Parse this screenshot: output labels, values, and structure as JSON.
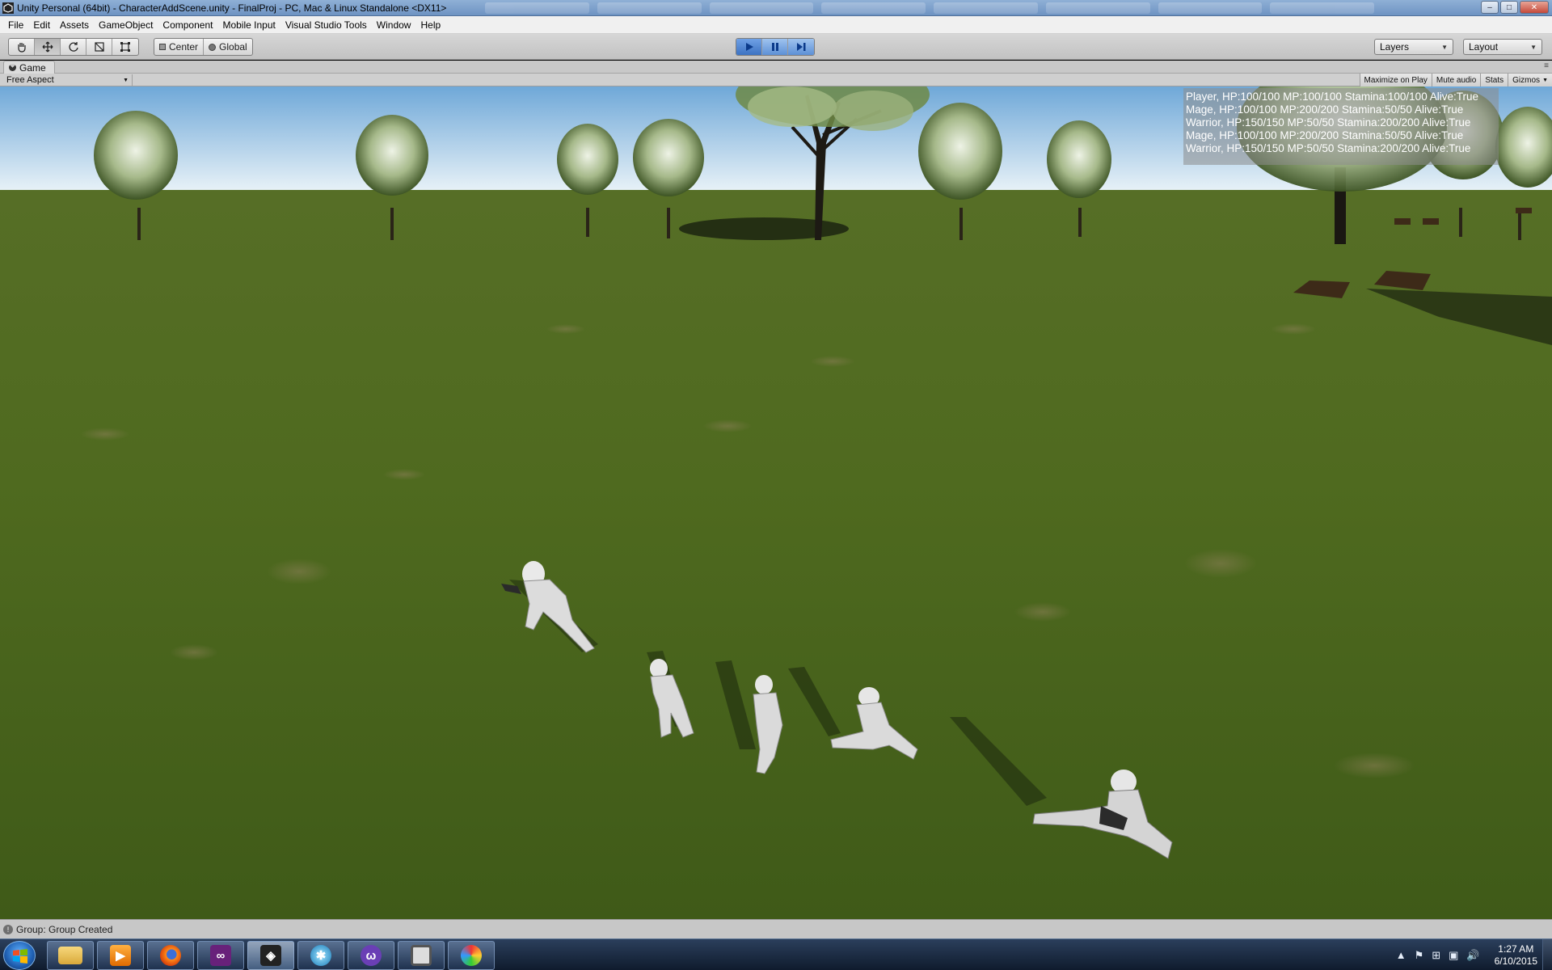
{
  "window": {
    "title": "Unity Personal (64bit) - CharacterAddScene.unity - FinalProj - PC, Mac & Linux Standalone <DX11>",
    "buttons": {
      "minimize": "–",
      "maximize": "□",
      "close": "✕"
    }
  },
  "menubar": {
    "items": [
      "File",
      "Edit",
      "Assets",
      "GameObject",
      "Component",
      "Mobile Input",
      "Visual Studio Tools",
      "Window",
      "Help"
    ]
  },
  "toolbar": {
    "transform_tools": [
      "hand-icon",
      "move-icon",
      "rotate-icon",
      "scale-icon",
      "rect-icon"
    ],
    "pivot_center_label": "Center",
    "pivot_global_label": "Global",
    "play_controls": [
      "play-icon",
      "pause-icon",
      "step-icon"
    ],
    "layers_label": "Layers",
    "layout_label": "Layout"
  },
  "game_panel": {
    "tab_label": "Game",
    "aspect_label": "Free Aspect",
    "toggles": [
      "Maximize on Play",
      "Mute audio",
      "Stats",
      "Gizmos"
    ],
    "hud_lines": [
      "Player, HP:100/100 MP:100/100 Stamina:100/100 Alive:True",
      "Mage, HP:100/100 MP:200/200 Stamina:50/50 Alive:True",
      "Warrior, HP:150/150 MP:50/50 Stamina:200/200 Alive:True",
      "Mage, HP:100/100 MP:200/200 Stamina:50/50 Alive:True",
      "Warrior, HP:150/150 MP:50/50 Stamina:200/200 Alive:True"
    ]
  },
  "statusbar": {
    "message": "Group: Group Created"
  },
  "taskbar": {
    "apps": [
      "windows-explorer-icon",
      "media-player-icon",
      "firefox-icon",
      "visual-studio-icon",
      "unity-icon",
      "app-icon",
      "cat-app-icon",
      "blank-app-icon",
      "paint-icon"
    ],
    "clock_time": "1:27 AM",
    "clock_date": "6/10/2015"
  },
  "colors": {
    "accent_play": "#3c72c2",
    "grass": "#4a6620",
    "sky": "#cfe2f0"
  }
}
